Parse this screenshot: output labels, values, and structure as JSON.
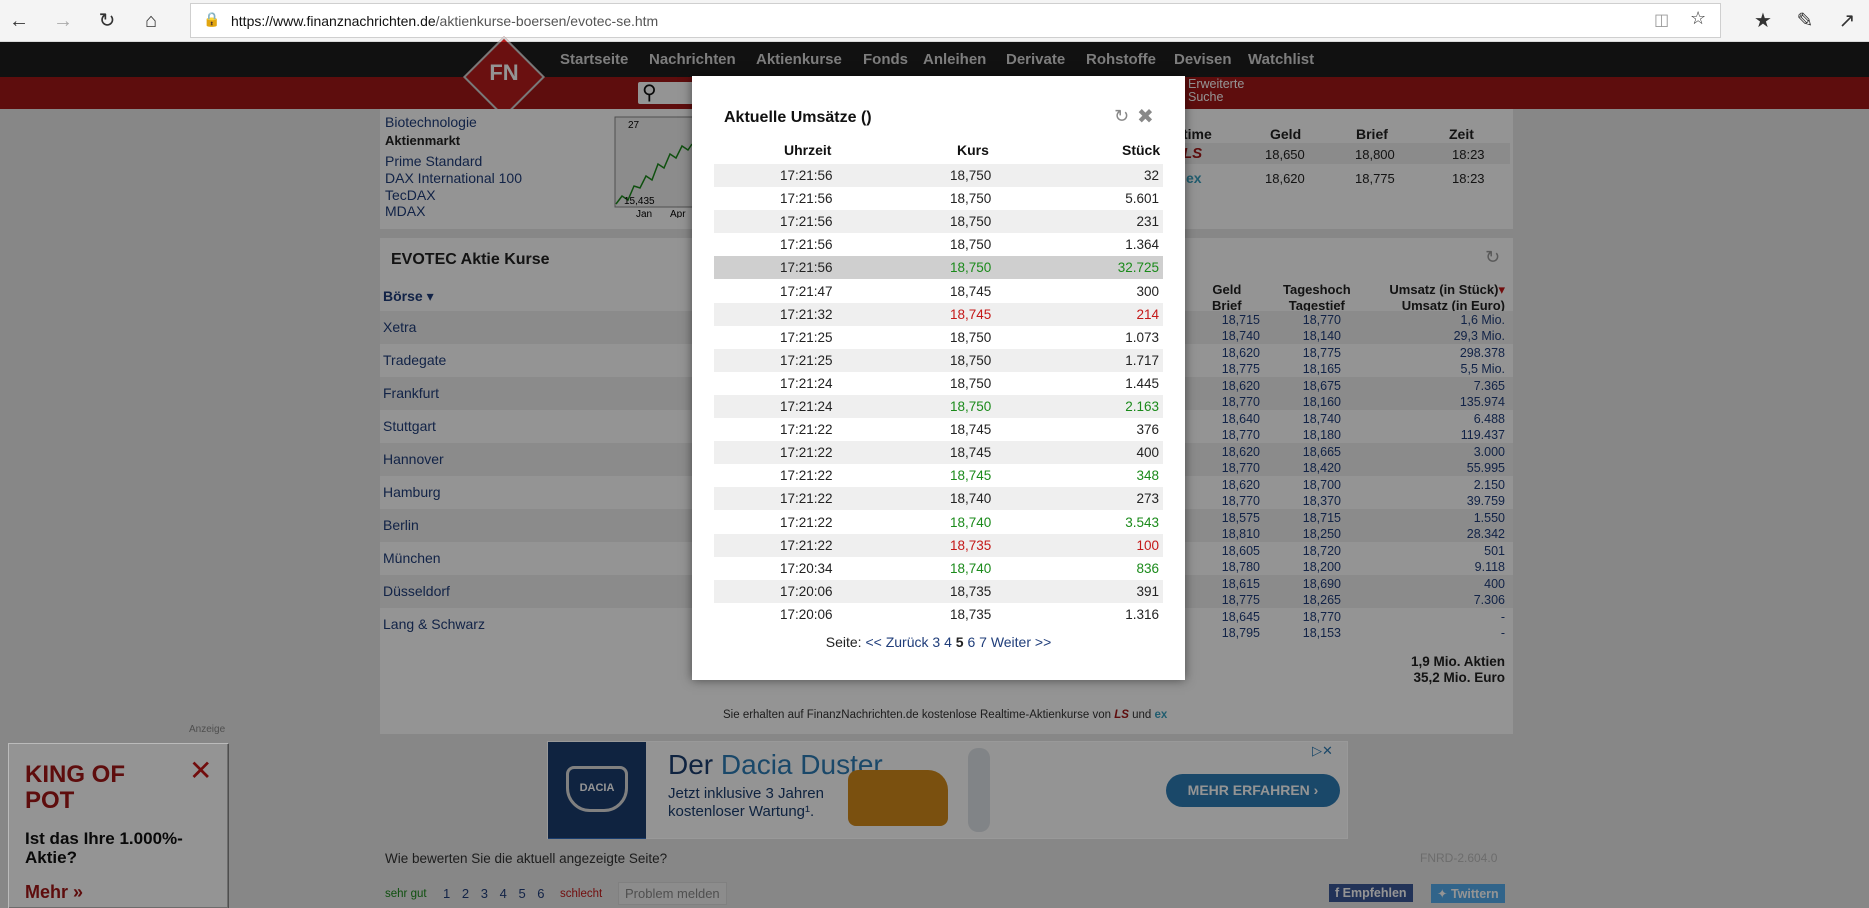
{
  "browser": {
    "url_host": "https://www.finanznachrichten.de",
    "url_path": "/aktienkurse-boersen/evotec-se.htm"
  },
  "site": {
    "logo": "FN",
    "menu": [
      "Startseite",
      "Nachrichten",
      "Aktienkurse",
      "Fonds",
      "Anleihen",
      "Derivate",
      "Rohstoffe",
      "Devisen",
      "Watchlist"
    ],
    "extended_search_1": "Erweiterte",
    "extended_search_2": "Suche",
    "sector": "Biotechnologie",
    "market_label": "Aktienmarkt",
    "indices": [
      "Prime Standard",
      "DAX International 100",
      "TecDAX",
      "MDAX"
    ],
    "chart_low": "15,435",
    "chart_months": [
      "Jan",
      "Apr"
    ],
    "chart_high_partial": "27",
    "realtime_header": [
      "time",
      "Geld",
      "Brief",
      "Zeit"
    ],
    "realtime_rows": [
      {
        "src": "LS",
        "geld": "18,650",
        "brief": "18,800",
        "zeit": "18:23"
      },
      {
        "src": "ex",
        "geld": "18,620",
        "brief": "18,775",
        "zeit": "18:23"
      }
    ],
    "kurse_title": "EVOTEC Aktie Kurse",
    "boerse_label": "Börse",
    "col_geld_brief_1": "Geld",
    "col_geld_brief_2": "Brief",
    "col_hoch_tief_1": "Tageshoch",
    "col_hoch_tief_2": "Tagestief",
    "col_umsatz_1": "Umsatz (in Stück)",
    "col_umsatz_2": "Umsatz (in Euro)",
    "exchanges": [
      {
        "name": "Xetra",
        "geld": "18,715",
        "brief": "18,740",
        "hoch": "18,770",
        "tief": "18,140",
        "stk": "1,6 Mio.",
        "eur": "29,3 Mio."
      },
      {
        "name": "Tradegate",
        "geld": "18,620",
        "brief": "18,775",
        "hoch": "18,775",
        "tief": "18,165",
        "stk": "298.378",
        "eur": "5,5 Mio."
      },
      {
        "name": "Frankfurt",
        "geld": "18,620",
        "brief": "18,770",
        "hoch": "18,675",
        "tief": "18,160",
        "stk": "7.365",
        "eur": "135.974"
      },
      {
        "name": "Stuttgart",
        "geld": "18,640",
        "brief": "18,770",
        "hoch": "18,740",
        "tief": "18,180",
        "stk": "6.488",
        "eur": "119.437"
      },
      {
        "name": "Hannover",
        "geld": "18,620",
        "brief": "18,770",
        "hoch": "18,665",
        "tief": "18,420",
        "stk": "3.000",
        "eur": "55.995"
      },
      {
        "name": "Hamburg",
        "geld": "18,620",
        "brief": "18,770",
        "hoch": "18,700",
        "tief": "18,370",
        "stk": "2.150",
        "eur": "39.759"
      },
      {
        "name": "Berlin",
        "geld": "18,575",
        "brief": "18,810",
        "hoch": "18,715",
        "tief": "18,250",
        "stk": "1.550",
        "eur": "28.342"
      },
      {
        "name": "München",
        "geld": "18,605",
        "brief": "18,780",
        "hoch": "18,720",
        "tief": "18,200",
        "stk": "501",
        "eur": "9.118"
      },
      {
        "name": "Düsseldorf",
        "geld": "18,615",
        "brief": "18,775",
        "hoch": "18,690",
        "tief": "18,265",
        "stk": "400",
        "eur": "7.306"
      },
      {
        "name": "Lang & Schwarz",
        "geld": "18,645",
        "brief": "18,795",
        "hoch": "18,770",
        "tief": "18,153",
        "stk": "-",
        "eur": "-"
      }
    ],
    "total_1": "1,9 Mio. Aktien",
    "total_2": "35,2 Mio. Euro",
    "realtime_notice": "Sie erhalten auf FinanzNachrichten.de kostenlose Realtime-Aktienkurse von",
    "realtime_und": "und",
    "anzeige": "Anzeige",
    "rating_question": "Wie bewerten Sie die aktuell angezeigte Seite?",
    "rating_good": "sehr gut",
    "rating_numbers": [
      "1",
      "2",
      "3",
      "4",
      "5",
      "6"
    ],
    "rating_bad": "schlecht",
    "report_problem": "Problem melden",
    "page_code": "FNRD-2.604.0",
    "share_fb": "Empfehlen",
    "share_tw": "Twittern"
  },
  "ad_popup": {
    "title_1": "KING OF",
    "title_2": "POT",
    "question_1": "Ist das Ihre 1.000%-",
    "question_2": "Aktie?",
    "cta": "Mehr »"
  },
  "banner": {
    "brand": "DACIA",
    "headline_1": "Der",
    "headline_2": "Dacia Duster",
    "sub_1": "Jetzt inklusive 3 Jahren",
    "sub_2": "kostenloser Wartung¹.",
    "cta": "MEHR ERFAHREN"
  },
  "modal": {
    "title": "Aktuelle Umsätze ()",
    "col_time": "Uhrzeit",
    "col_price": "Kurs",
    "col_qty": "Stück",
    "rows": [
      {
        "t": "17:21:56",
        "k": "18,750",
        "s": "32",
        "c": ""
      },
      {
        "t": "17:21:56",
        "k": "18,750",
        "s": "5.601",
        "c": ""
      },
      {
        "t": "17:21:56",
        "k": "18,750",
        "s": "231",
        "c": ""
      },
      {
        "t": "17:21:56",
        "k": "18,750",
        "s": "1.364",
        "c": ""
      },
      {
        "t": "17:21:56",
        "k": "18,750",
        "s": "32.725",
        "c": "up"
      },
      {
        "t": "17:21:47",
        "k": "18,745",
        "s": "300",
        "c": ""
      },
      {
        "t": "17:21:32",
        "k": "18,745",
        "s": "214",
        "c": "down"
      },
      {
        "t": "17:21:25",
        "k": "18,750",
        "s": "1.073",
        "c": ""
      },
      {
        "t": "17:21:25",
        "k": "18,750",
        "s": "1.717",
        "c": ""
      },
      {
        "t": "17:21:24",
        "k": "18,750",
        "s": "1.445",
        "c": ""
      },
      {
        "t": "17:21:24",
        "k": "18,750",
        "s": "2.163",
        "c": "up"
      },
      {
        "t": "17:21:22",
        "k": "18,745",
        "s": "376",
        "c": ""
      },
      {
        "t": "17:21:22",
        "k": "18,745",
        "s": "400",
        "c": ""
      },
      {
        "t": "17:21:22",
        "k": "18,745",
        "s": "348",
        "c": "up"
      },
      {
        "t": "17:21:22",
        "k": "18,740",
        "s": "273",
        "c": ""
      },
      {
        "t": "17:21:22",
        "k": "18,740",
        "s": "3.543",
        "c": "up"
      },
      {
        "t": "17:21:22",
        "k": "18,735",
        "s": "100",
        "c": "down"
      },
      {
        "t": "17:20:34",
        "k": "18,740",
        "s": "836",
        "c": "up"
      },
      {
        "t": "17:20:06",
        "k": "18,735",
        "s": "391",
        "c": ""
      },
      {
        "t": "17:20:06",
        "k": "18,735",
        "s": "1.316",
        "c": ""
      }
    ],
    "pager_label": "Seite:",
    "pager_back": "<< Zurück",
    "pages": [
      "3",
      "4",
      "5",
      "6",
      "7"
    ],
    "current_page": "5",
    "pager_next": "Weiter >>"
  },
  "colors": {
    "brand_red": "#a31818",
    "nav_dark": "#1e1e1e",
    "link": "#1f3d7a",
    "up": "#1a8a1a",
    "down": "#c41818"
  }
}
